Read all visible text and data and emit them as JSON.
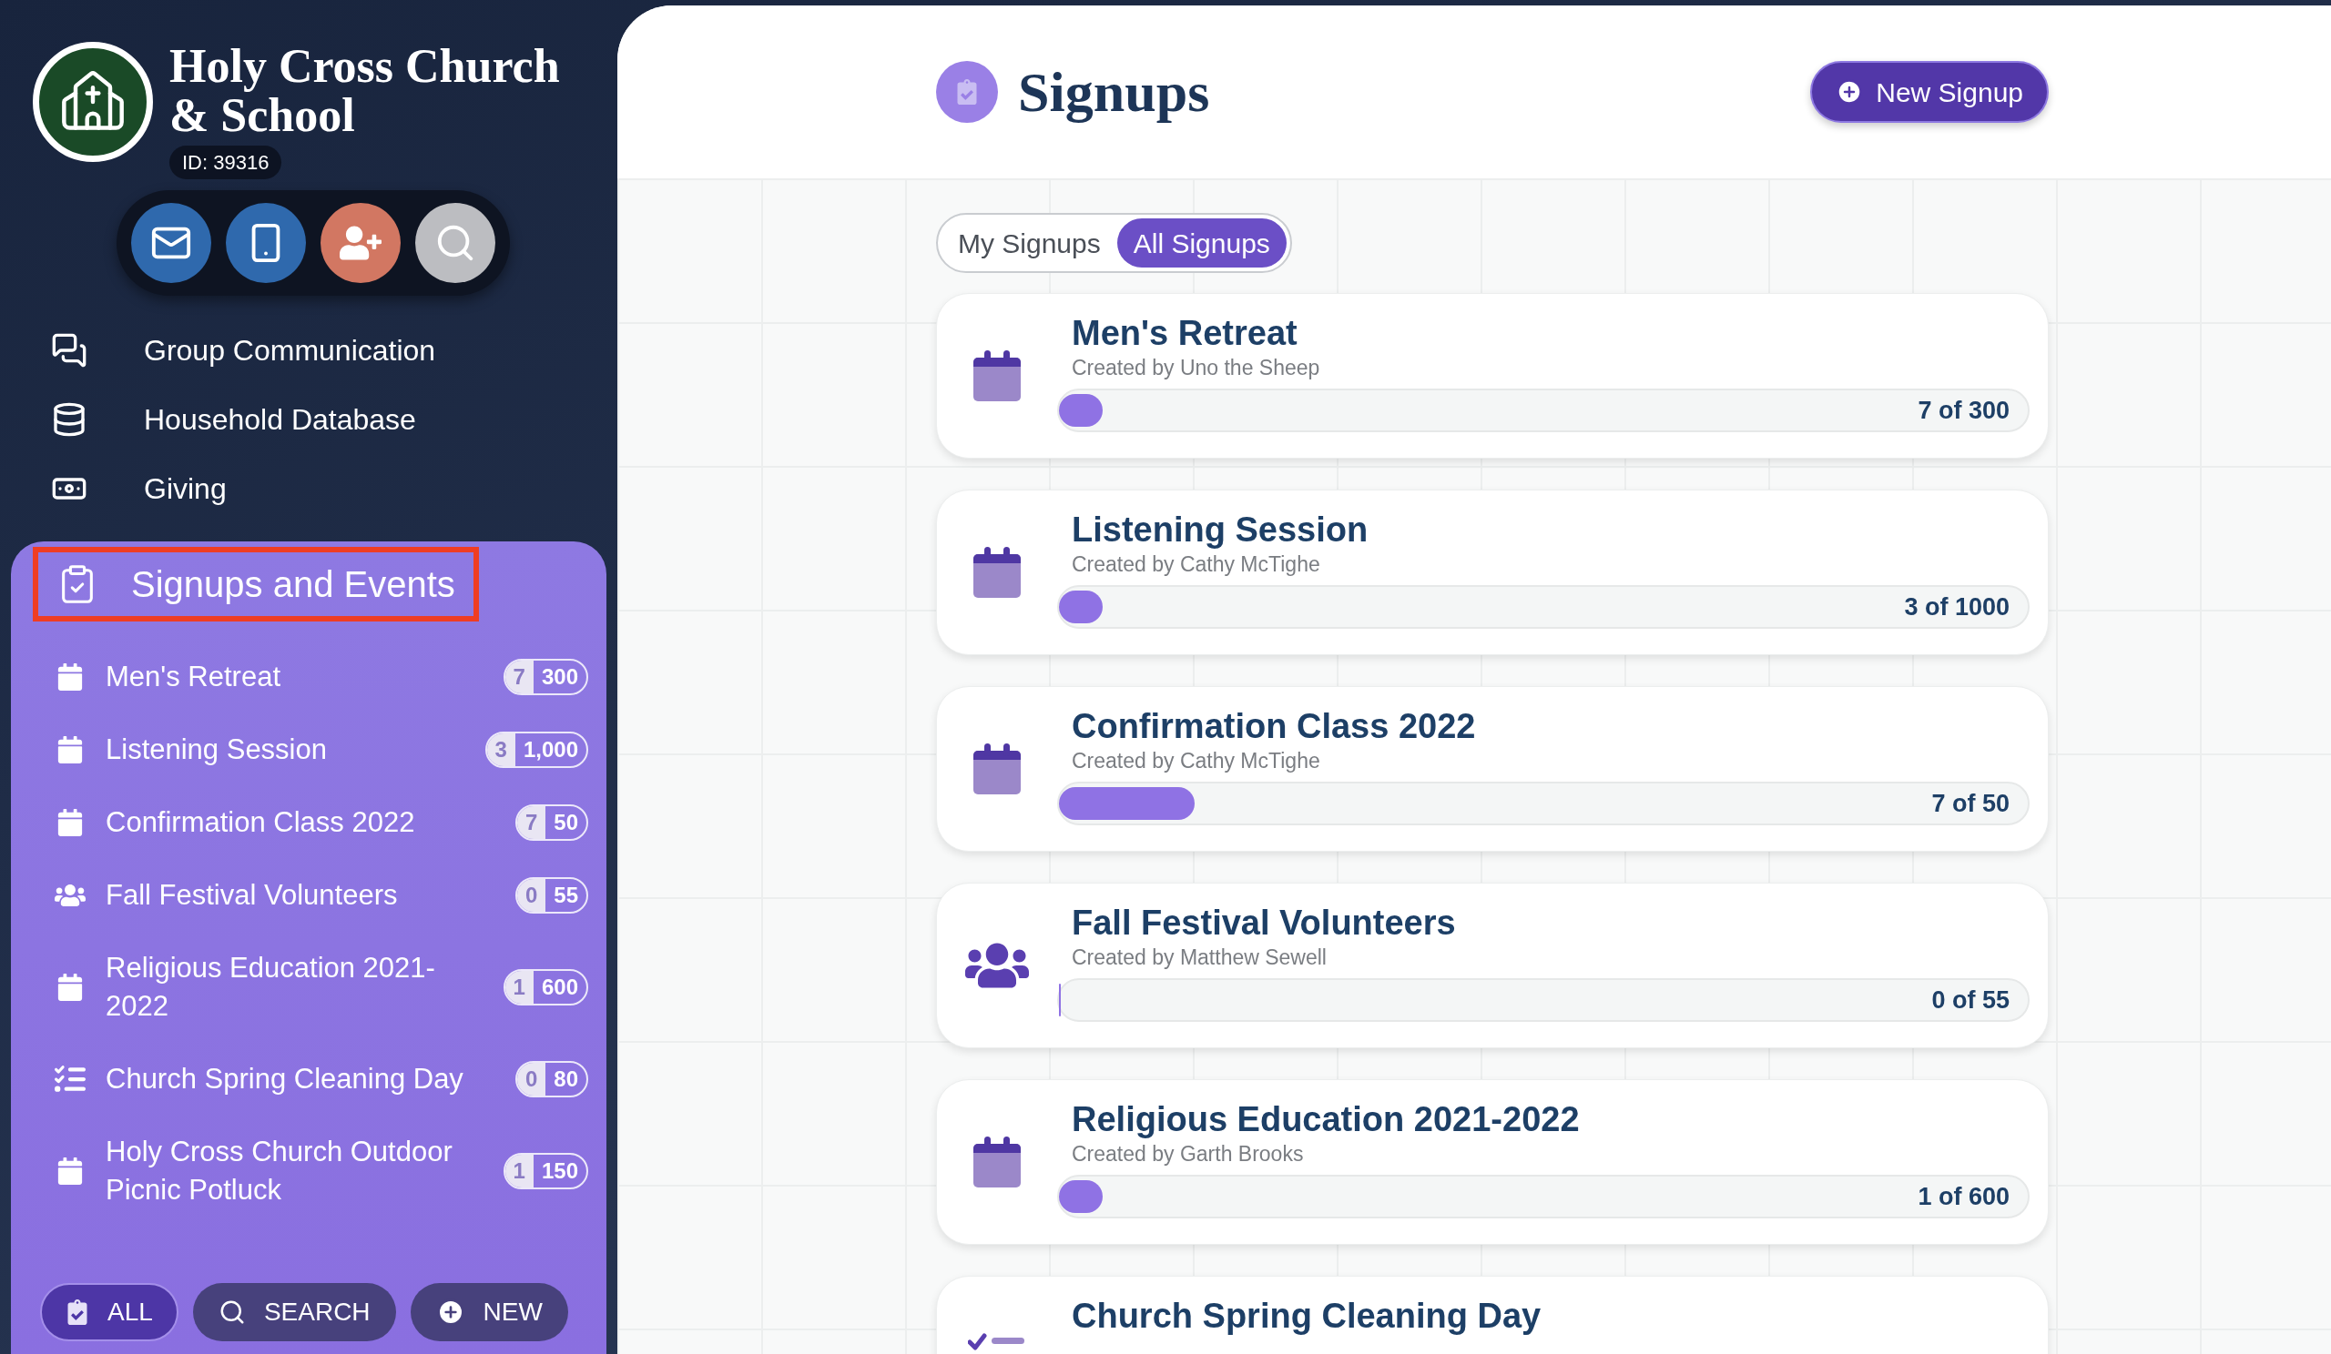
{
  "org": {
    "name": "Holy Cross Church & School",
    "id": "ID: 39316"
  },
  "nav": [
    {
      "label": "Group Communication",
      "kind": "chat"
    },
    {
      "label": "Household Database",
      "kind": "database"
    },
    {
      "label": "Giving",
      "kind": "money"
    }
  ],
  "signups_panel": {
    "title": "Signups and Events",
    "highlighted": true,
    "items": [
      {
        "label": "Men's Retreat",
        "kind": "event",
        "count": "7",
        "total": "300"
      },
      {
        "label": "Listening Session",
        "kind": "event",
        "count": "3",
        "total": "1,000"
      },
      {
        "label": "Confirmation Class 2022",
        "kind": "event",
        "count": "7",
        "total": "50"
      },
      {
        "label": "Fall Festival Volunteers",
        "kind": "group",
        "count": "0",
        "total": "55"
      },
      {
        "label": "Religious Education 2021-2022",
        "kind": "event",
        "count": "1",
        "total": "600"
      },
      {
        "label": "Church Spring Cleaning Day",
        "kind": "checklist",
        "count": "0",
        "total": "80"
      },
      {
        "label": "Holy Cross Church Outdoor Picnic Potluck",
        "kind": "event",
        "count": "1",
        "total": "150"
      }
    ],
    "buttons": [
      {
        "label": "ALL",
        "kind": "all",
        "selected": true
      },
      {
        "label": "SEARCH",
        "kind": "search",
        "selected": false
      },
      {
        "label": "NEW",
        "kind": "new",
        "selected": false
      }
    ]
  },
  "main": {
    "title": "Signups",
    "new_button": "New Signup",
    "filter_tabs": [
      {
        "label": "My Signups",
        "selected": false
      },
      {
        "label": "All Signups",
        "selected": true
      }
    ],
    "cards": [
      {
        "title": "Men's Retreat",
        "creator": "Created by Uno the Sheep",
        "kind": "event",
        "level": 0.023,
        "reading": "7 of 300"
      },
      {
        "title": "Listening Session",
        "creator": "Created by Cathy McTighe",
        "kind": "event",
        "level": 0.003,
        "reading": "3 of 1000"
      },
      {
        "title": "Confirmation Class 2022",
        "creator": "Created by Cathy McTighe",
        "kind": "event",
        "level": 0.14,
        "reading": "7 of 50"
      },
      {
        "title": "Fall Festival Volunteers",
        "creator": "Created by Matthew Sewell",
        "kind": "group",
        "level": 0,
        "reading": "0 of 55"
      },
      {
        "title": "Religious Education 2021-2022",
        "creator": "Created by Garth Brooks",
        "kind": "event",
        "level": 0.0017,
        "reading": "1 of 600"
      },
      {
        "title": "Church Spring Cleaning Day",
        "kind": "checklist"
      }
    ]
  }
}
